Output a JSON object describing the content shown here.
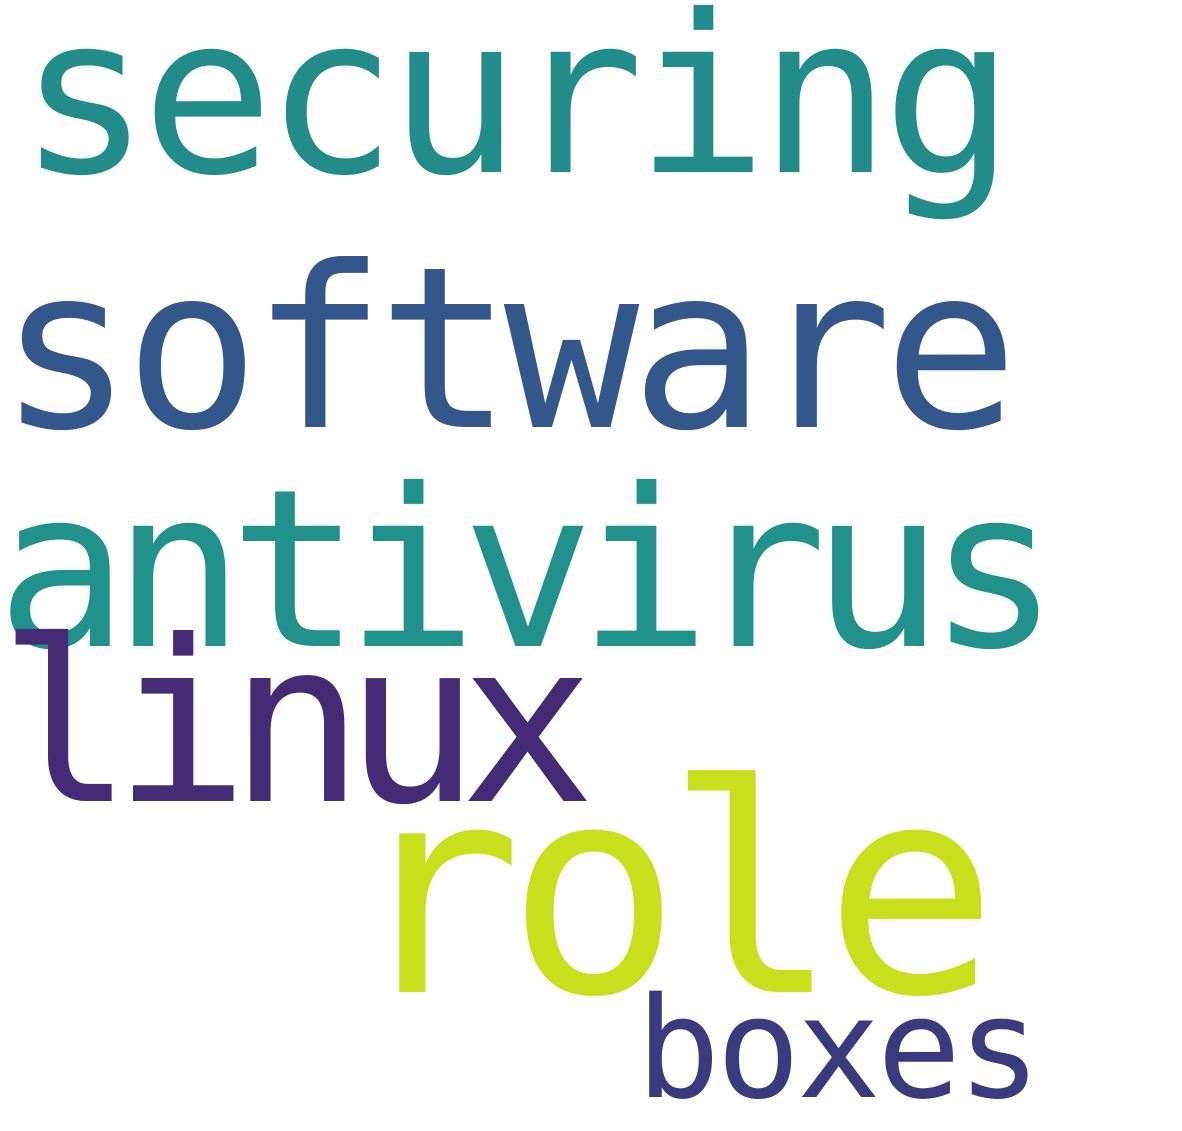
{
  "wordcloud": {
    "background": "#ffffff",
    "words": [
      {
        "id": "securing",
        "text": "securing",
        "color": "#228c8a"
      },
      {
        "id": "software",
        "text": "software",
        "color": "#33568b"
      },
      {
        "id": "antivirus",
        "text": "antivirus",
        "color": "#21918c"
      },
      {
        "id": "linux",
        "text": "linux",
        "color": "#452a76"
      },
      {
        "id": "role",
        "text": "role",
        "color": "#c8df1c"
      },
      {
        "id": "boxes",
        "text": "boxes",
        "color": "#3a3a7e"
      }
    ]
  }
}
